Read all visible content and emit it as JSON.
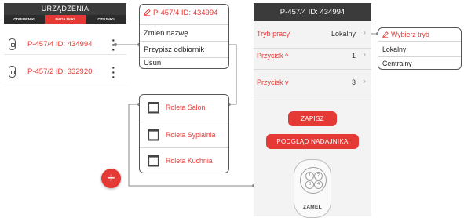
{
  "devices_panel": {
    "title": "URZĄDZENIA",
    "tabs": [
      {
        "label": "ODBIORNIKI",
        "active": false
      },
      {
        "label": "NADAJNIKI",
        "active": true
      },
      {
        "label": "CZUJNIKI",
        "active": false
      }
    ],
    "items": [
      {
        "label": "P-457/4 ID: 434994",
        "icon": "remote-device-icon"
      },
      {
        "label": "P-457/2 ID: 332920",
        "icon": "remote-device-icon"
      }
    ],
    "add_button": "+"
  },
  "context_menu": {
    "title": "P-457/4 ID: 434994",
    "title_icon": "pencil-icon",
    "items": [
      "Zmień nazwę",
      "Przypisz odbiornik",
      "Usuń"
    ]
  },
  "receivers": {
    "items": [
      "Roleta Salon",
      "Roleta Sypialnia",
      "Roleta Kuchnia"
    ],
    "icon": "blind-icon"
  },
  "detail": {
    "title": "P-457/4 ID: 434994",
    "rows": [
      {
        "label": "Tryb pracy",
        "value": "Lokalny"
      },
      {
        "label": "Przycisk ^",
        "value": "1"
      },
      {
        "label": "Przycisk v",
        "value": "3"
      }
    ],
    "save_label": "ZAPISZ",
    "preview_label": "PODGLĄD NADAJNIKA",
    "remote_buttons": [
      "1",
      "2",
      "3",
      "4"
    ],
    "brand": "ZAMEL"
  },
  "mode_dropdown": {
    "title": "Wybierz tryb",
    "options": [
      "Lokalny",
      "Centralny"
    ]
  },
  "colors": {
    "accent": "#e53935",
    "header": "#3b3b3b"
  }
}
